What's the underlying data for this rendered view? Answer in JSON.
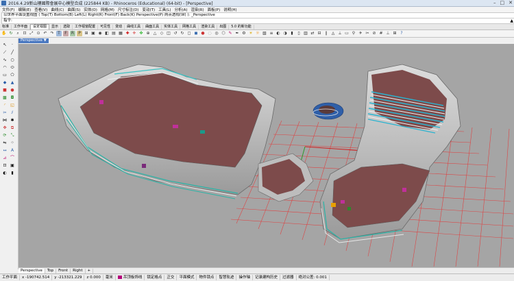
{
  "window": {
    "title": "2016.4.29新山樓國際會展中心模型合成 (225844 KB) - Rhinoceros (Educational) (64-bit) - [Perspective]",
    "minimize": "–",
    "maximize": "□",
    "close": "✕"
  },
  "menu": [
    "文件(F)",
    "编辑(E)",
    "查看(V)",
    "曲线(C)",
    "曲面(S)",
    "实体(O)",
    "网格(M)",
    "尺寸标注(D)",
    "变动(T)",
    "工具(L)",
    "分析(A)",
    "渲染(R)",
    "面板(P)",
    "说明(H)"
  ],
  "command": {
    "history": "以世界平面设置视图 ( Top(T)  Bottom(B)  Left(L)  Right(R)  Front(F)  Back(K)  Perspective(P)  两点透视(W) ): _Perspective",
    "prompt": "指令:",
    "maximize_label": "▲"
  },
  "toolbar_tabs": [
    "标准",
    "工作平面",
    "设定视图",
    "显示",
    "选取",
    "工作视窗配置",
    "可见性",
    "变动",
    "曲线工具",
    "曲面工具",
    "实体工具",
    "网格工具",
    "渲染工具",
    "出图",
    "5.0 的新功能"
  ],
  "toolbar_tabs_active_index": 2,
  "toolbar_icons": [
    "pan-icon",
    "rotate-view-icon",
    "zoom-icon",
    "zoom-window-icon",
    "zoom-extents-icon",
    "zoom-selected-icon",
    "undo-view-icon",
    "redo-view-icon",
    "top-view-icon",
    "front-view-icon",
    "right-view-icon",
    "perspective-view-icon",
    "four-view-icon",
    "maximize-view-icon",
    "camera-icon",
    "set-view-icon",
    "named-views-icon",
    "named-cplane-icon",
    "cplane-top-icon",
    "cplane-front-icon",
    "cplane-right-icon",
    "cplane-origin-icon",
    "cplane-3pt-icon",
    "cplane-object-icon",
    "cplane-view-icon",
    "undo-cplane-icon",
    "redo-cplane-icon",
    "wireframe-icon",
    "shaded-icon",
    "rendered-icon",
    "ghosted-icon",
    "xray-icon",
    "technical-icon",
    "artistic-icon",
    "pen-icon",
    "display-options-icon",
    "lights-icon",
    "sun-icon",
    "background-icon",
    "layer-icon",
    "hide-icon",
    "show-icon",
    "lock-icon",
    "unlock-icon",
    "properties-icon",
    "match-icon",
    "split-view-icon",
    "parallel-icon",
    "perspective-lens-icon",
    "two-point-icon",
    "flat-icon",
    "walk-icon",
    "fly-icon",
    "clipping-icon",
    "section-icon",
    "grid-icon",
    "axes-icon",
    "cplane-grid-icon",
    "help-icon"
  ],
  "viewport": {
    "label": "Perspective",
    "label_arrow": "▼",
    "background": "#a5a5a5"
  },
  "view_tabs": [
    "Perspective",
    "Top",
    "Front",
    "Right",
    "+"
  ],
  "view_tabs_active_index": 0,
  "status": {
    "cplane": "工作平面",
    "x": "x -190742.514",
    "y": "y -213321.229",
    "z": "z 0.000",
    "units": "毫米",
    "layer": "吊顶板饰线",
    "layer_color": "#b4007a",
    "osnap": "锁定格点",
    "ortho": "正交",
    "planar": "平面模式",
    "objsnap": "物件锁点",
    "smarttrack": "智慧轨迹",
    "gumball": "操作轴",
    "history": "记录建构历史",
    "filter": "过滤器",
    "absolute_tolerance": "绝对公差: 0.001"
  }
}
